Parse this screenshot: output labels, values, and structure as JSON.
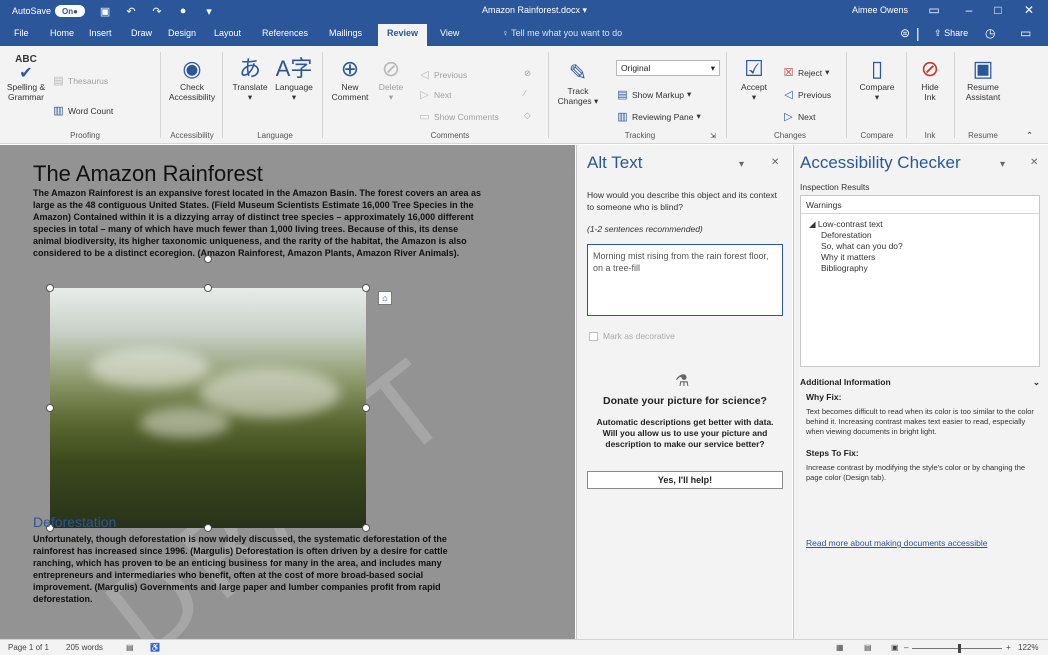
{
  "titlebar": {
    "autosave_label": "AutoSave",
    "autosave_state": "On",
    "document_title": "Amazon Rainforest.docx",
    "user_name": "Aimee Owens"
  },
  "tabs": [
    {
      "label": "File"
    },
    {
      "label": "Home"
    },
    {
      "label": "Insert"
    },
    {
      "label": "Draw"
    },
    {
      "label": "Design"
    },
    {
      "label": "Layout"
    },
    {
      "label": "References"
    },
    {
      "label": "Mailings"
    },
    {
      "label": "Review"
    },
    {
      "label": "View"
    }
  ],
  "active_tab": "Review",
  "tell_me": "Tell me what you want to do",
  "share_label": "Share",
  "ribbon": {
    "spelling": "Spelling &\nGrammar",
    "thesaurus": "Thesaurus",
    "word_count": "Word Count",
    "check_accessibility": "Check\nAccessibility",
    "translate": "Translate",
    "language": "Language",
    "new_comment": "New\nComment",
    "delete": "Delete",
    "previous_comment": "Previous",
    "next_comment": "Next",
    "show_comments": "Show Comments",
    "track_changes": "Track\nChanges",
    "markup_view": "Original",
    "show_markup": "Show Markup",
    "reviewing_pane": "Reviewing Pane",
    "accept": "Accept",
    "reject": "Reject",
    "previous_change": "Previous",
    "next_change": "Next",
    "compare": "Compare",
    "hide_ink": "Hide\nInk",
    "resume_assistant": "Resume\nAssistant",
    "groups": {
      "proofing": "Proofing",
      "accessibility": "Accessibility",
      "language": "Language",
      "comments": "Comments",
      "tracking": "Tracking",
      "changes": "Changes",
      "compare": "Compare",
      "ink": "Ink",
      "resume": "Resume"
    }
  },
  "document": {
    "title": "The Amazon Rainforest",
    "paragraph1_lines": [
      "The Amazon Rainforest is an expansive forest located in the Amazon Basin.  The forest covers an area as",
      "large as the 48 contiguous United States. (Field Museum Scientists Estimate 16,000 Tree Species in the",
      "Amazon)  Contained within it is a dizzying array of distinct tree species – approximately 16,000 different",
      "species in total – many of which have much fewer than 1,000 living trees.  Because of this, its dense",
      "animal biodiversity, its higher taxonomic uniqueness, and the rarity of the habitat, the Amazon is also",
      "considered to be a distinct ecoregion. (Amazon Rainforest, Amazon Plants, Amazon River Animals)."
    ],
    "watermark": "DRAFT",
    "heading2": "Deforestation",
    "paragraph2_lines": [
      "Unfortunately, though deforestation is now widely discussed, the systematic deforestation of the",
      "rainforest has increased since 1996. (Margulis) Deforestation is often driven by a desire for cattle",
      "ranching, which has proven to be an enticing business for many in the area, and includes many",
      "entrepreneurs and intermediaries who benefit, often at the cost of more broad-based social",
      "improvement. (Margulis) Governments and large paper and lumber companies profit from rapid",
      "deforestation."
    ]
  },
  "alt_text": {
    "title": "Alt Text",
    "question": "How would you describe this object and its context to someone who is blind?",
    "recommendation": "(1-2 sentences recommended)",
    "value": "Morning mist rising from the rain forest floor, on a tree-fill",
    "mark_decorative": "Mark as decorative",
    "donate_heading": "Donate your picture for science?",
    "donate_text": "Automatic descriptions get better with data. Will you allow us to use your picture and description to make our service better?",
    "yes_button": "Yes, I'll help!"
  },
  "checker": {
    "title": "Accessibility Checker",
    "inspection_results": "Inspection Results",
    "warnings": "Warnings",
    "items": [
      {
        "label": "Low-contrast text",
        "expanded": true
      },
      {
        "label": "Deforestation"
      },
      {
        "label": "So, what can you do?"
      },
      {
        "label": "Why it matters"
      },
      {
        "label": "Bibliography"
      }
    ],
    "additional_info": "Additional Information",
    "why_fix": "Why Fix:",
    "why_fix_text": "Text becomes difficult to read when its color is too similar to the color behind it. Increasing contrast makes text easier to read, especially when viewing documents in bright light.",
    "steps_to_fix": "Steps To Fix:",
    "steps_text": "Increase contrast by modifying the style's color or by changing the page color (Design tab).",
    "read_more": "Read more about making documents accessible"
  },
  "status": {
    "page": "Page 1 of 1",
    "words": "205 words",
    "zoom": "122%"
  },
  "colors": {
    "brand": "#2b579a",
    "doc_background": "#939393"
  }
}
